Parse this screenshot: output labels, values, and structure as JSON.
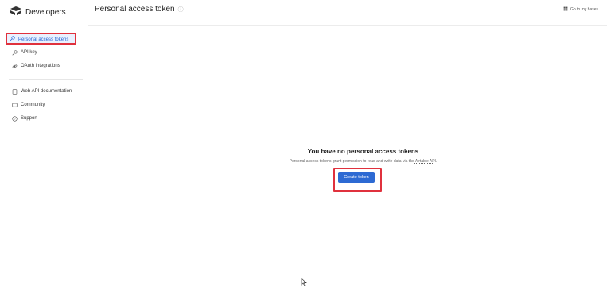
{
  "app": {
    "brand": "Developers"
  },
  "sidebar": {
    "items": [
      {
        "label": "Personal access tokens",
        "icon": "key-icon",
        "active": true
      },
      {
        "label": "API key",
        "icon": "key-icon"
      },
      {
        "label": "OAuth integrations",
        "icon": "link-icon"
      },
      {
        "label": "Web API documentation",
        "icon": "book-icon"
      },
      {
        "label": "Community",
        "icon": "chat-icon"
      },
      {
        "label": "Support",
        "icon": "help-icon"
      }
    ]
  },
  "header": {
    "title": "Personal access token",
    "goto_label": "Go to my bases"
  },
  "main": {
    "empty_title": "You have no personal access tokens",
    "empty_desc_prefix": "Personal access tokens grant permission to read and write data via the ",
    "empty_desc_link": "Airtable API",
    "empty_desc_suffix": ".",
    "create_button": "Create token"
  },
  "colors": {
    "accent": "#2d6ad3",
    "highlight": "#e0313d"
  }
}
